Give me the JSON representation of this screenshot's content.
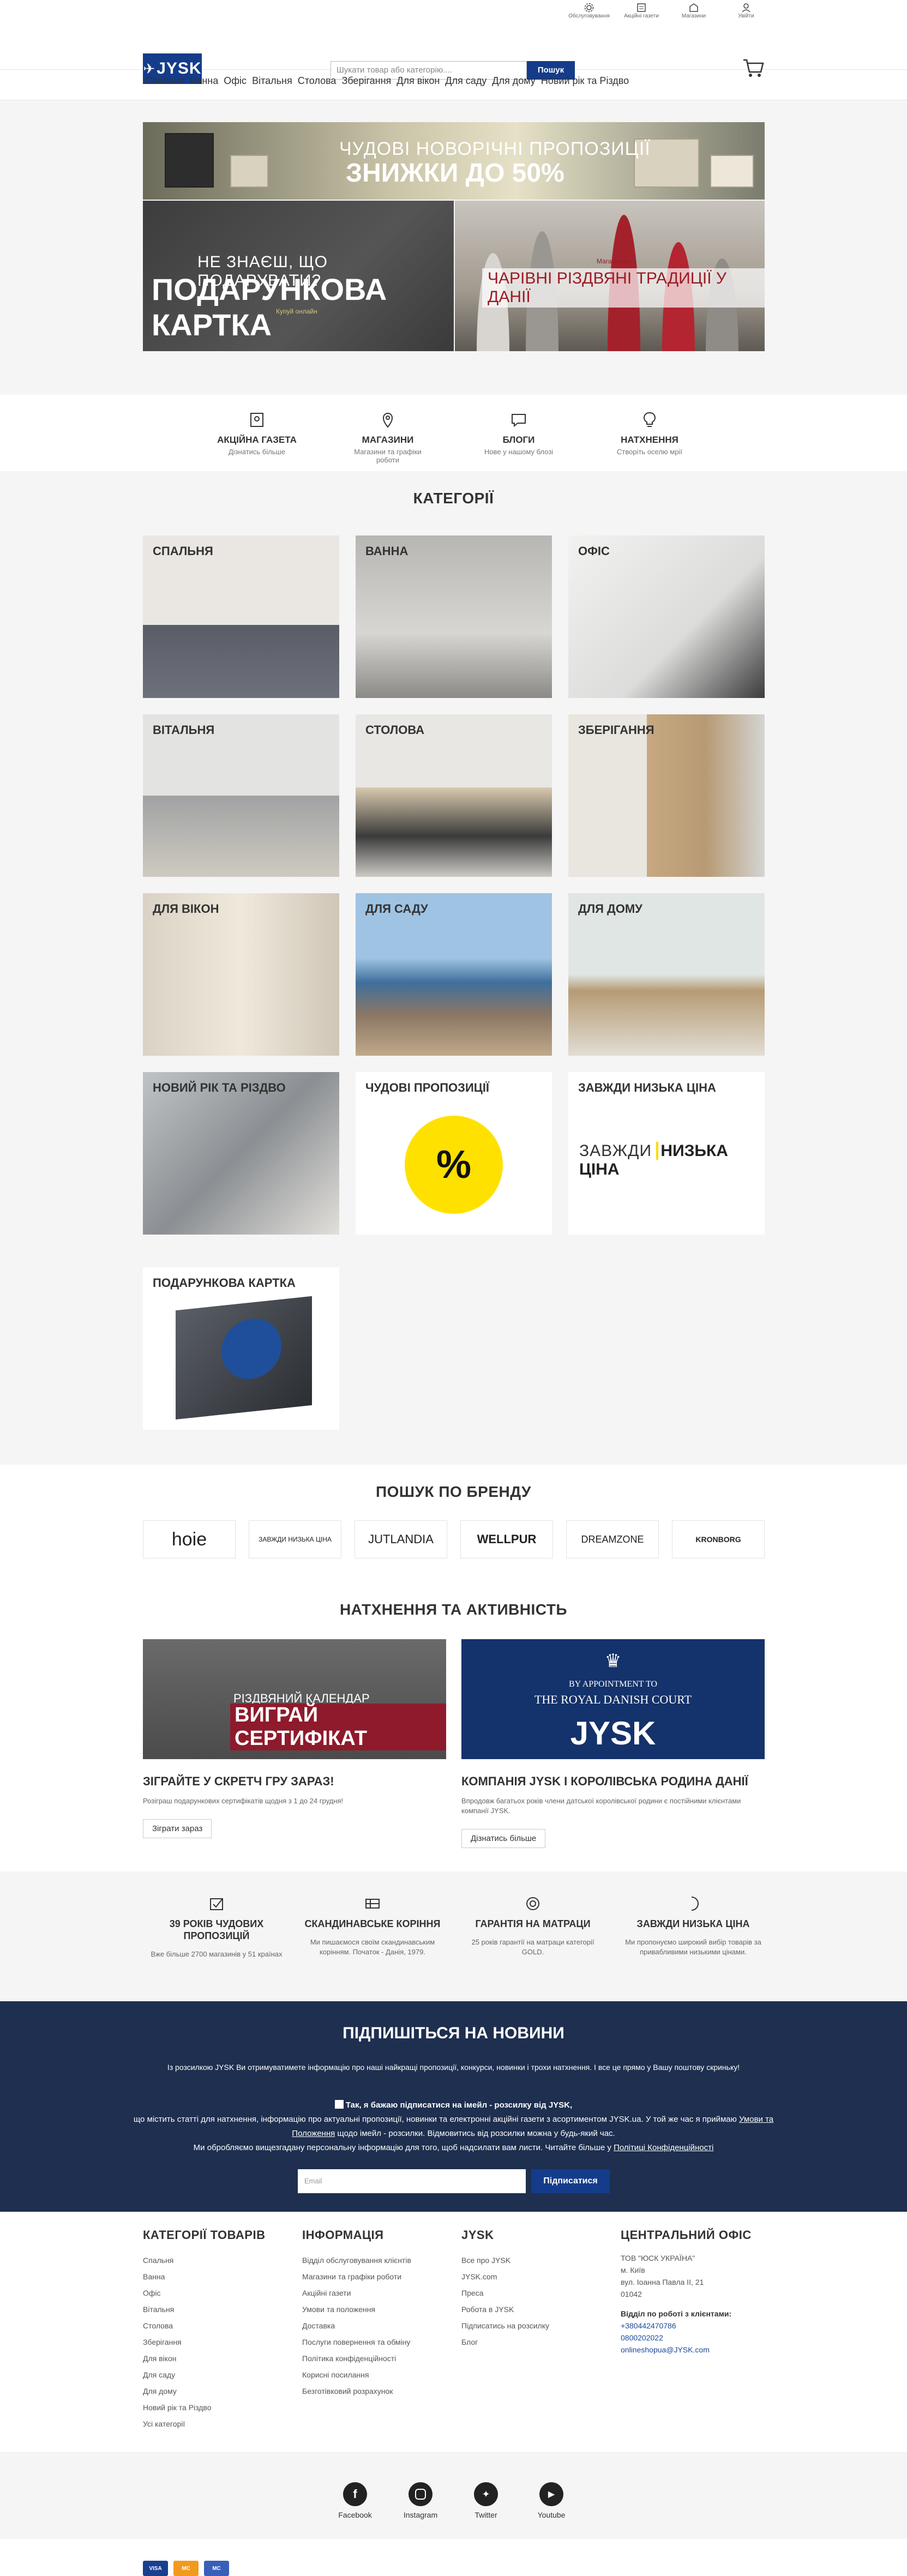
{
  "topbar": {
    "links": [
      {
        "label": "Обслуговування",
        "icon": "gear-icon"
      },
      {
        "label": "Акційні газети",
        "icon": "newspaper-icon"
      },
      {
        "label": "Магазини",
        "icon": "store-icon"
      },
      {
        "label": "Увійти",
        "icon": "user-icon"
      }
    ]
  },
  "header": {
    "logo": "JYSK",
    "search_placeholder": "Шукати товар або категорію....",
    "search_button": "Пошук"
  },
  "nav": [
    "Спальня",
    "Ванна",
    "Офіс",
    "Вітальня",
    "Столова",
    "Зберігання",
    "Для вікон",
    "Для саду",
    "Для дому",
    "Новий рік та Різдво"
  ],
  "hero": {
    "banner1_line1": "ЧУДОВІ НОВОРІЧНІ ПРОПОЗИЦІЇ",
    "banner1_line2": "ЗНИЖКИ ДО 50%",
    "banner2_line1": "НЕ ЗНАЄШ, ЩО ПОДАРУВАТИ?",
    "banner2_line2": "ПОДАРУНКОВА КАРТКА",
    "banner2_line3": "Купуй онлайн",
    "banner3_line1": "Магазинам",
    "banner3_line2": "ЧАРІВНІ РІЗДВЯНІ ТРАДИЦІЇ У ДАНІЇ"
  },
  "quick_links": [
    {
      "title": "АКЦІЙНА ГАЗЕТА",
      "sub": "Дізнатись більше",
      "icon": "newspaper-icon"
    },
    {
      "title": "МАГАЗИНИ",
      "sub": "Магазини та графіки роботи",
      "icon": "location-icon"
    },
    {
      "title": "БЛОГИ",
      "sub": "Нове у нашому блозі",
      "icon": "chat-icon"
    },
    {
      "title": "НАТХНЕННЯ",
      "sub": "Створіть оселю мрії",
      "icon": "bulb-icon"
    }
  ],
  "categories": {
    "heading": "КАТЕГОРІЇ",
    "items": [
      "СПАЛЬНЯ",
      "ВАННА",
      "ОФІС",
      "ВІТАЛЬНЯ",
      "СТОЛОВА",
      "ЗБЕРІГАННЯ",
      "ДЛЯ ВІКОН",
      "ДЛЯ САДУ",
      "ДЛЯ ДОМУ",
      "НОВИЙ РІК ТА РІЗДВО",
      "ЧУДОВІ ПРОПОЗИЦІЇ",
      "ЗАВЖДИ НИЗЬКА ЦІНА",
      "ПОДАРУНКОВА КАРТКА"
    ],
    "percent": "%",
    "low_price_logo_a": "ЗАВЖДИ",
    "low_price_logo_b": "НИЗЬКА ЦІНА"
  },
  "brands": {
    "heading": "ПОШУК ПО БРЕНДУ",
    "items": [
      "hoie",
      "ЗАВЖДИ НИЗЬКА ЦІНА",
      "JUTLANDIA",
      "WELLPUR",
      "DREAMZONE",
      "KRONBORG"
    ]
  },
  "inspiration": {
    "heading": "НАТХНЕННЯ ТА АКТИВНІСТЬ",
    "cards": [
      {
        "img_line1": "РІЗДВЯНИЙ КАЛЕНДАР",
        "img_line2": "ВИГРАЙ СЕРТИФІКАТ",
        "title": "ЗІГРАЙТЕ У СКРЕТЧ ГРУ ЗАРАЗ!",
        "desc": "Розіграш подарункових сертифікатів щодня з 1 до 24 грудня!",
        "button": "Зіграти зараз"
      },
      {
        "img_line1": "BY APPOINTMENT TO",
        "img_line2": "THE ROYAL DANISH COURT",
        "img_line3": "JYSK",
        "title": "КОМПАНІЯ JYSK І КОРОЛІВСЬКА РОДИНА ДАНІЇ",
        "desc": "Впродовж багатьох років члени датської королівської родини є постійними клієнтами компанії JYSK.",
        "button": "Дізнатись більше"
      }
    ]
  },
  "usp": [
    {
      "title": "39 РОКІВ ЧУДОВИХ ПРОПОЗИЦІЙ",
      "desc": "Вже більше 2700 магазинів у 51 країнах",
      "icon": "check-icon"
    },
    {
      "title": "СКАНДИНАВСЬКЕ КОРІННЯ",
      "desc": "Ми пишаємося своїм скандинавським корінням. Початок - Данія, 1979.",
      "icon": "flag-icon"
    },
    {
      "title": "ГАРАНТІЯ НА МАТРАЦИ",
      "desc": "25 років гарантії на матраци категорії GOLD.",
      "icon": "target-icon"
    },
    {
      "title": "ЗАВЖДИ НИЗЬКА ЦІНА",
      "desc": "Ми пропонуємо широкий вибір товарів за привабливими низькими цінами.",
      "icon": "crescent-icon"
    }
  ],
  "newsletter": {
    "title": "ПІДПИШІТЬСЯ НА НОВИНИ",
    "text": "Із розсилкою JYSK Ви отримуватимете інформацію про наші найкращі пропозиції, конкурси, новинки і трохи натхнення. І все це прямо у Вашу поштову скриньку!",
    "consent_bold": "Так, я бажаю підписатися на імейл - розсилку від JYSK,",
    "consent_line2": "що містить статті для натхнення, інформацію про актуальні пропозиції, новинки та електронні акційні газети з асортиментом JYSK.ua. У той же час я приймаю",
    "consent_link1": "Умови та Положення",
    "consent_line3": "щодо імейл - розсилки. Відмовитись від розсилки можна у будь-який час.",
    "consent_line4": "Ми обробляємо вищезгадану персональну інформацію для того, щоб надсилати вам листи. Читайте більше у",
    "consent_link2": "Політиці Конфіденційності",
    "email_placeholder": "Email",
    "button": "Підписатися"
  },
  "footer": {
    "col1": {
      "heading": "КАТЕГОРІЇ ТОВАРІВ",
      "items": [
        "Спальня",
        "Ванна",
        "Офіс",
        "Вітальня",
        "Столова",
        "Зберігання",
        "Для вікон",
        "Для саду",
        "Для дому",
        "Новий рік та Різдво",
        "Усі категорії"
      ]
    },
    "col2": {
      "heading": "ІНФОРМАЦІЯ",
      "items": [
        "Відділ обслуговування клієнтів",
        "Магазини та графіки роботи",
        "Акційні газети",
        "Умови та положення",
        "Доставка",
        "Послуги повернення та обміну",
        "Політика конфіденційності",
        "Корисні посилання",
        "Безготівковий розрахунок"
      ]
    },
    "col3": {
      "heading": "JYSK",
      "items": [
        "Все про JYSK",
        "JYSK.com",
        "Преса",
        "Робота в JYSK",
        "Підписатись на розсилку",
        "Блог"
      ]
    },
    "col4": {
      "heading": "ЦЕНТРАЛЬНИЙ ОФІС",
      "addr1": "ТОВ \"ЮСК УКРАЇНА\"",
      "addr2": "м. Київ",
      "addr3": "вул. Іоанна Павла II, 21",
      "addr4": "01042",
      "support_heading": "Відділ по роботі з клієнтами:",
      "phone1": "+380442470786",
      "phone2": "0800202022",
      "email": "onlineshopua@JYSK.com"
    }
  },
  "social": [
    {
      "label": "Facebook",
      "icon": "facebook-icon"
    },
    {
      "label": "Instagram",
      "icon": "instagram-icon"
    },
    {
      "label": "Twitter",
      "icon": "twitter-icon"
    },
    {
      "label": "Youtube",
      "icon": "youtube-icon"
    }
  ],
  "payments": [
    "VISA",
    "MC",
    "MC"
  ]
}
